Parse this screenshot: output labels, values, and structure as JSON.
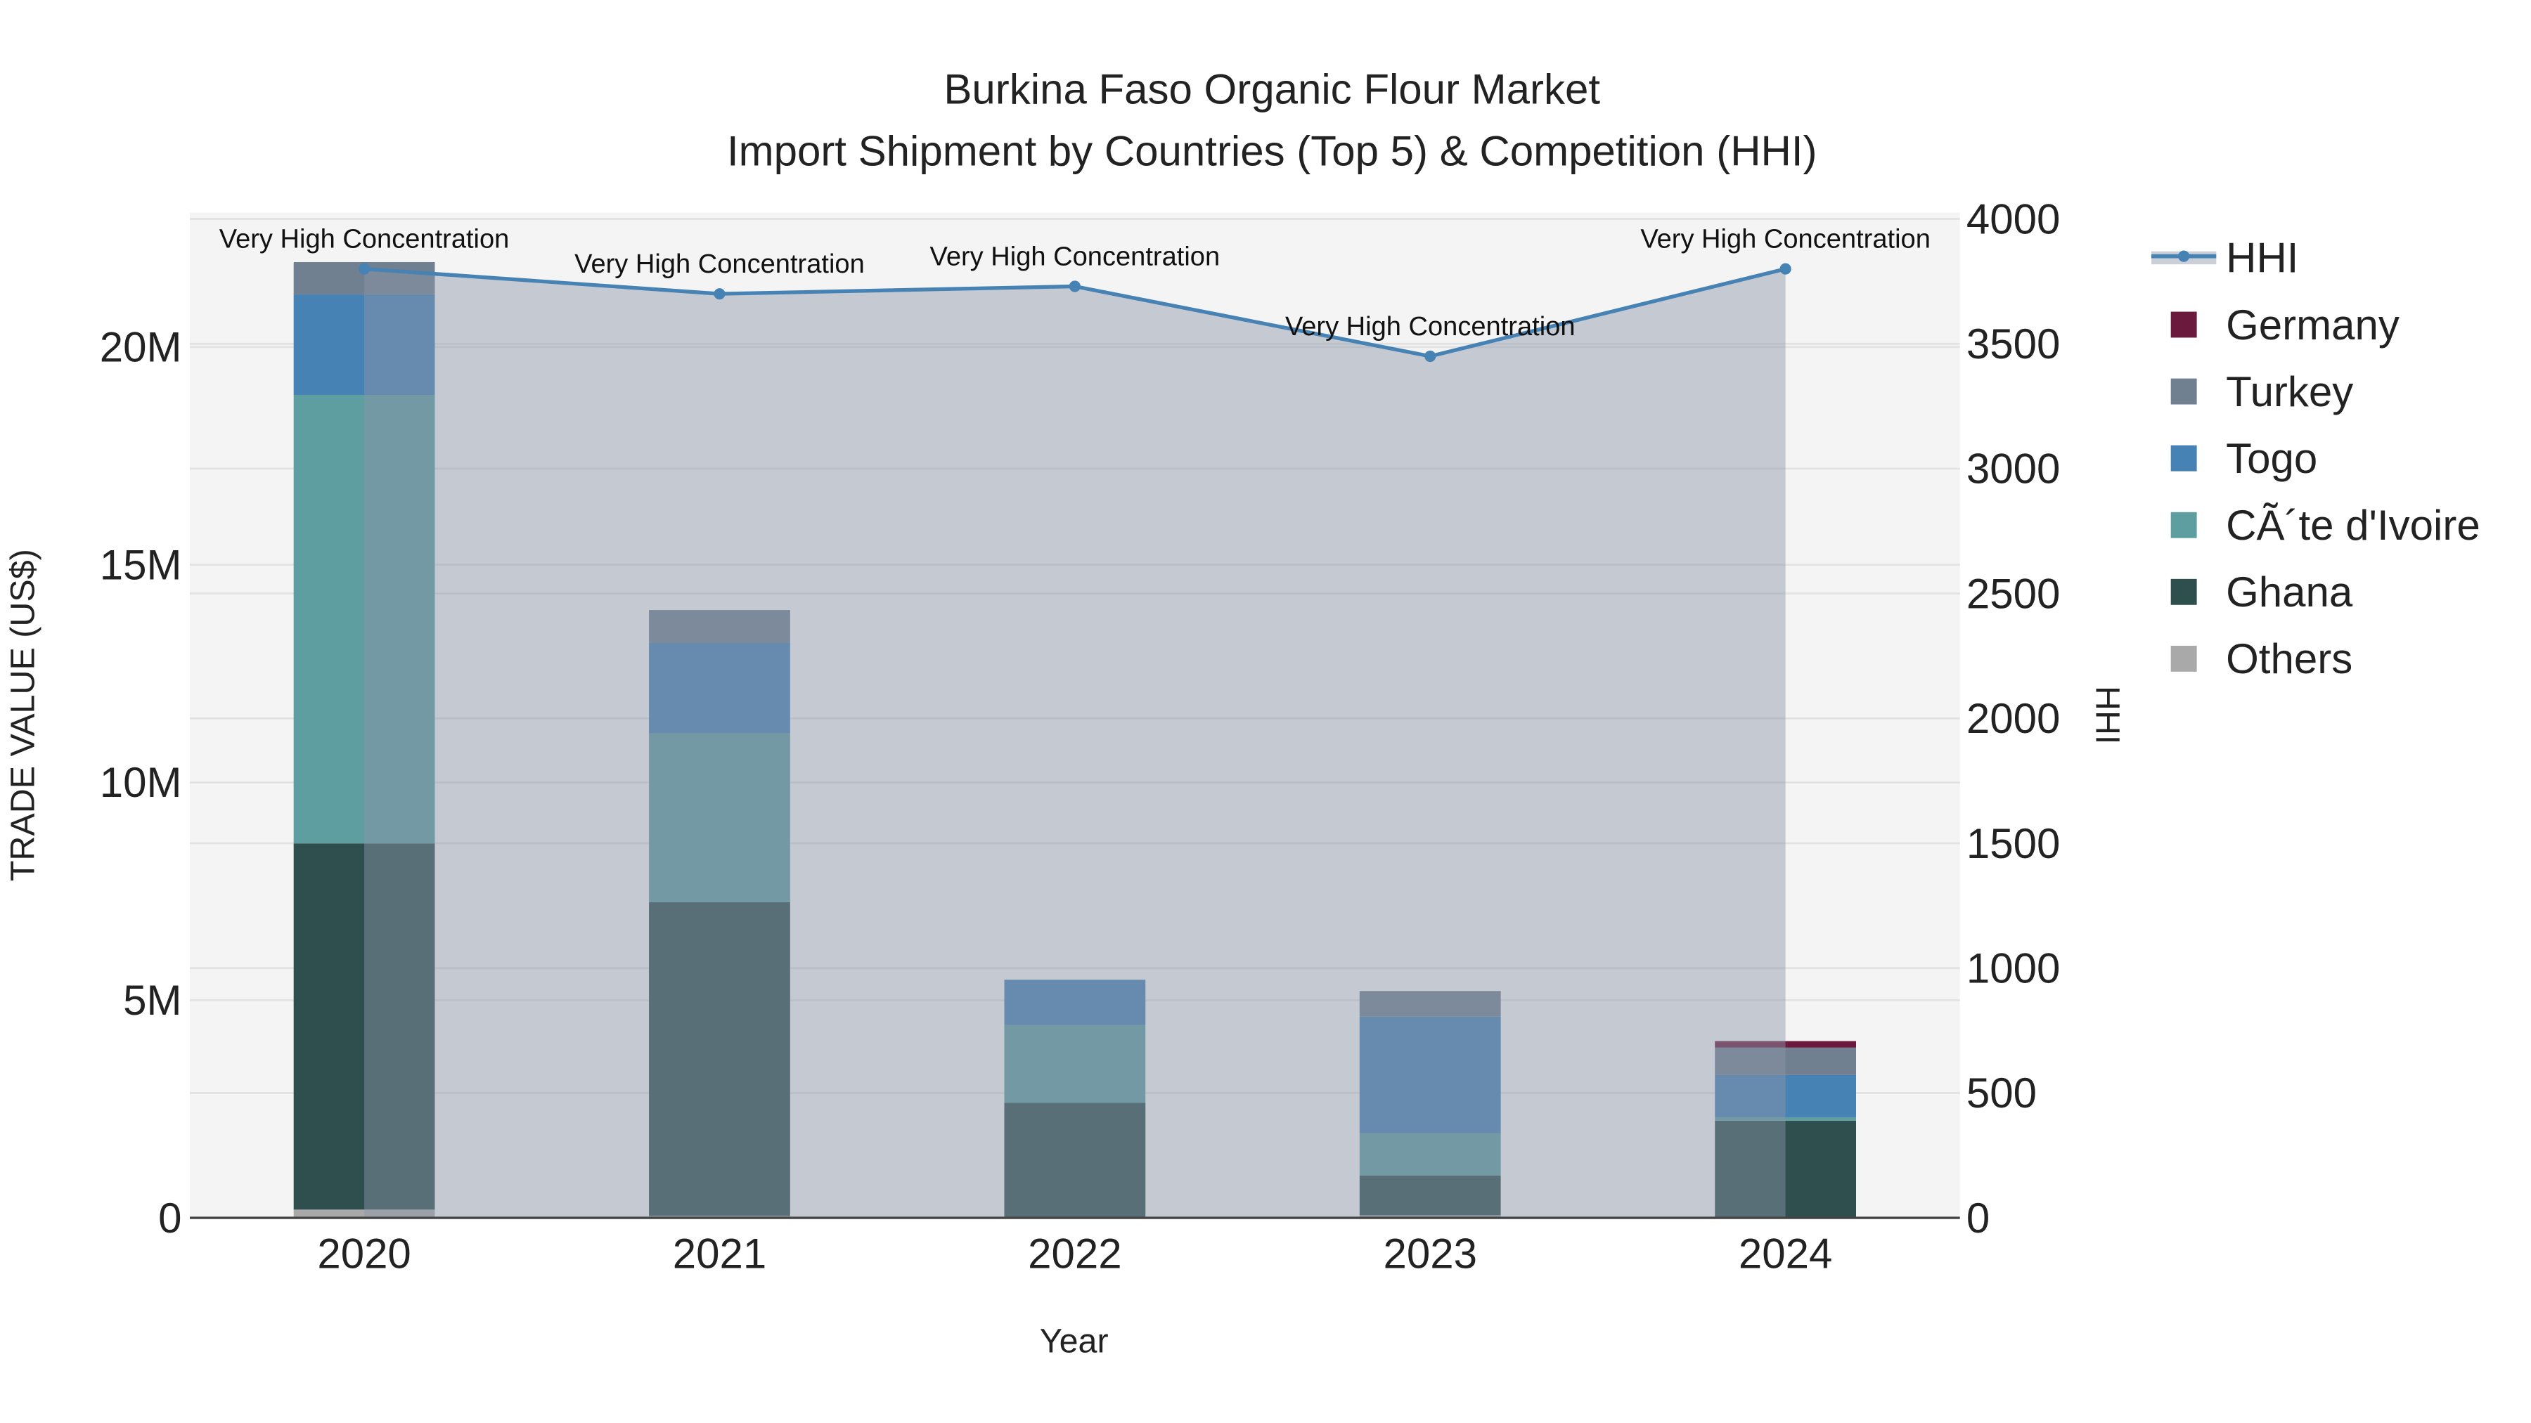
{
  "chart_data": {
    "type": "bar",
    "title_line1": "Burkina Faso Organic Flour Market",
    "title_line2": "Import Shipment by Countries (Top 5) & Competition (HHI)",
    "xlabel": "Year",
    "ylabel": "TRADE VALUE (US$)",
    "y2label": "HHI",
    "categories": [
      "2020",
      "2021",
      "2022",
      "2023",
      "2024"
    ],
    "ylim": [
      0,
      22.2
    ],
    "y_unit": "M",
    "yticks": [
      0,
      5,
      10,
      15,
      20
    ],
    "ytick_labels": [
      "0",
      "5M",
      "10M",
      "15M",
      "20M"
    ],
    "y2lim": [
      0,
      4000
    ],
    "y2ticks": [
      0,
      500,
      1000,
      1500,
      2000,
      2500,
      3000,
      3500,
      4000
    ],
    "y2tick_labels": [
      "0",
      "500",
      "1000",
      "1500",
      "2000",
      "2500",
      "3000",
      "3500",
      "4000"
    ],
    "series": [
      {
        "name": "Others",
        "color": "#a9a9a9",
        "values": [
          0.19,
          0.05,
          0.02,
          0.06,
          0.0
        ]
      },
      {
        "name": "Ghana",
        "color": "#2f4f4f",
        "values": [
          8.41,
          7.2,
          2.62,
          0.91,
          2.23
        ]
      },
      {
        "name": "CÃ´te d'Ivoire",
        "color": "#5f9ea0",
        "values": [
          10.3,
          3.88,
          1.79,
          0.97,
          0.08
        ]
      },
      {
        "name": "Togo",
        "color": "#4682b4",
        "values": [
          2.31,
          2.08,
          1.04,
          2.68,
          0.97
        ]
      },
      {
        "name": "Turkey",
        "color": "#708090",
        "values": [
          0.74,
          0.75,
          0.0,
          0.59,
          0.63
        ]
      },
      {
        "name": "Germany",
        "color": "#6b1a3e",
        "values": [
          0.0,
          0.0,
          0.0,
          0.0,
          0.15
        ]
      }
    ],
    "hhi": {
      "name": "HHI",
      "color": "#4682b4",
      "values": [
        3800,
        3700,
        3730,
        3450,
        3800
      ],
      "annotations": [
        "Very High Concentration",
        "Very High Concentration",
        "Very High Concentration",
        "Very High Concentration",
        "Very High Concentration"
      ]
    },
    "legend_order": [
      "HHI",
      "Germany",
      "Turkey",
      "Togo",
      "CÃ´te d'Ivoire",
      "Ghana",
      "Others"
    ],
    "legend_position": "right"
  }
}
